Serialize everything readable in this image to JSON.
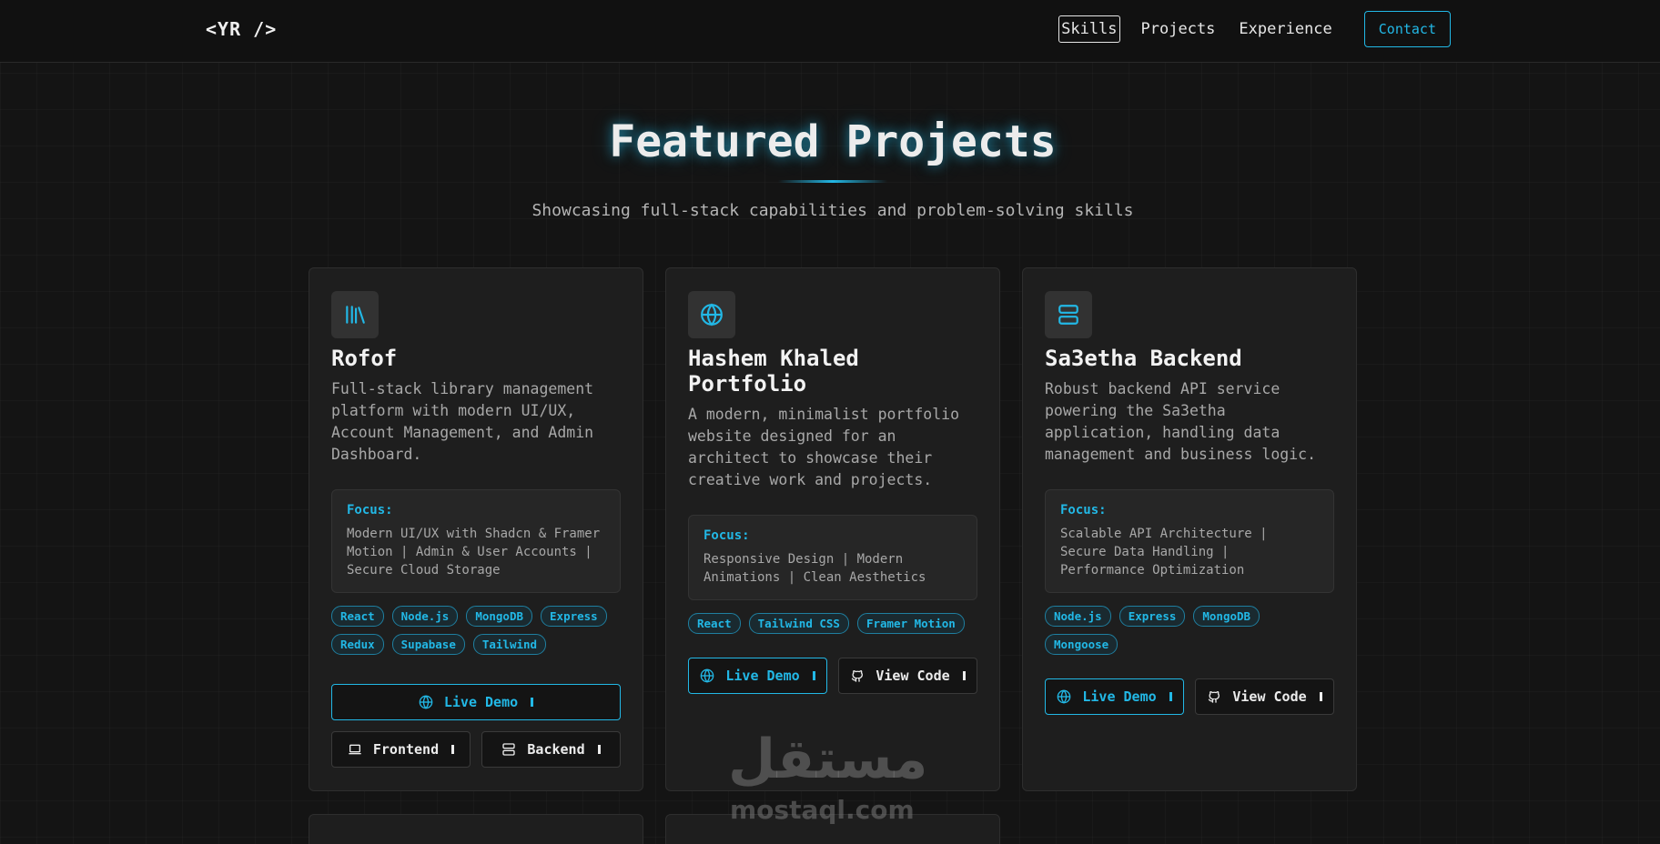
{
  "nav": {
    "logo": "<YR />",
    "links": [
      "Skills",
      "Projects",
      "Experience"
    ],
    "contact": "Contact"
  },
  "header": {
    "title": "Featured Projects",
    "subtitle": "Showcasing full-stack capabilities and problem-solving skills"
  },
  "projects": [
    {
      "icon": "library-icon",
      "title": "Rofof",
      "description": "Full-stack library management platform with modern UI/UX, Account Management, and Admin Dashboard.",
      "focus_label": "Focus:",
      "focus": "Modern UI/UX with Shadcn & Framer Motion | Admin & User Accounts | Secure Cloud Storage",
      "tags": [
        "React",
        "Node.js",
        "MongoDB",
        "Express",
        "Redux",
        "Supabase",
        "Tailwind"
      ],
      "buttons": {
        "demo": "Live Demo",
        "frontend": "Frontend",
        "backend": "Backend"
      }
    },
    {
      "icon": "globe-icon",
      "title": "Hashem Khaled Portfolio",
      "description": "A modern, minimalist portfolio website designed for an architect to showcase their creative work and projects.",
      "focus_label": "Focus:",
      "focus": "Responsive Design | Modern Animations | Clean Aesthetics",
      "tags": [
        "React",
        "Tailwind CSS",
        "Framer Motion"
      ],
      "buttons": {
        "demo": "Live Demo",
        "code": "View Code"
      }
    },
    {
      "icon": "server-icon",
      "title": "Sa3etha Backend",
      "description": "Robust backend API service powering the Sa3etha application, handling data management and business logic.",
      "focus_label": "Focus:",
      "focus": "Scalable API Architecture | Secure Data Handling | Performance Optimization",
      "tags": [
        "Node.js",
        "Express",
        "MongoDB",
        "Mongoose"
      ],
      "buttons": {
        "demo": "Live Demo",
        "code": "View Code"
      }
    }
  ],
  "watermark": {
    "arabic": "مستقل",
    "latin": "mostaql.com"
  },
  "colors": {
    "accent": "#22b8e6",
    "background": "#141414",
    "card": "#1e1e1e"
  }
}
